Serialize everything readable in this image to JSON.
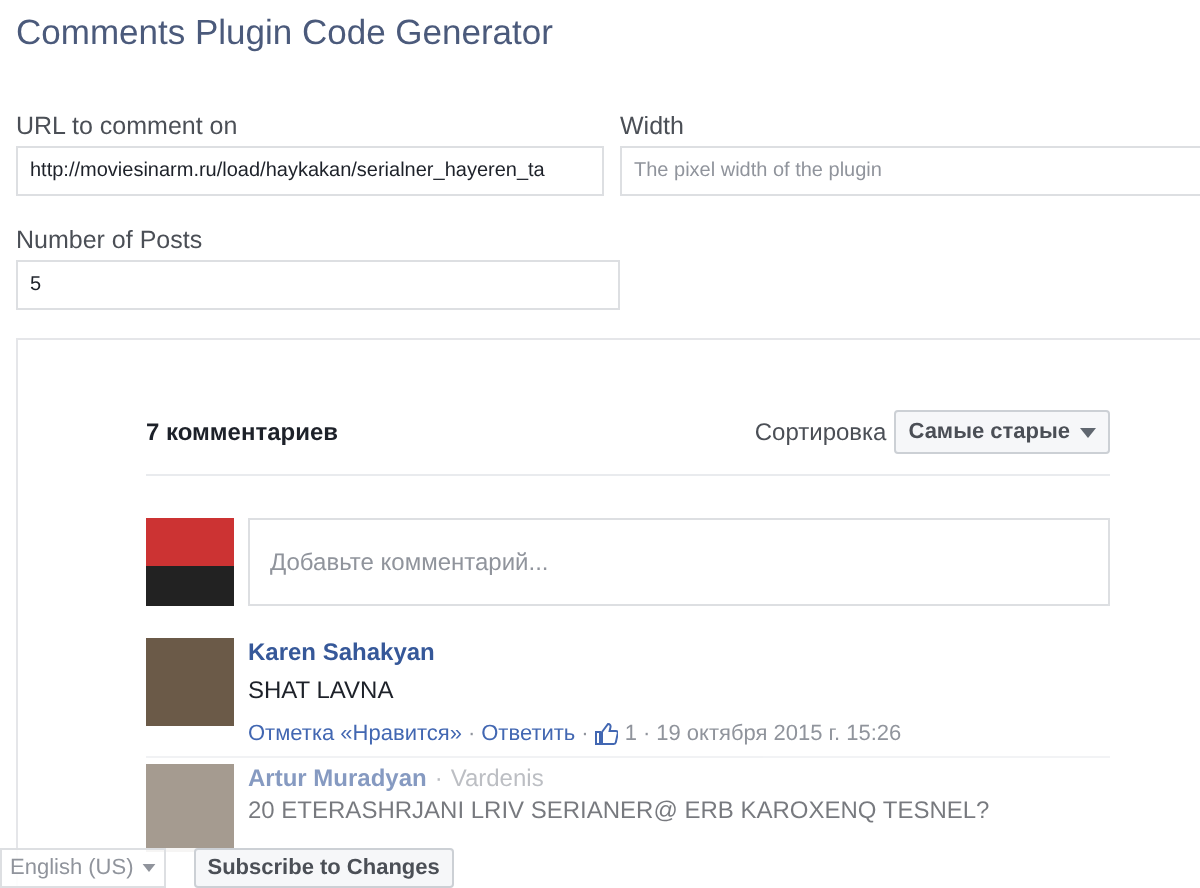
{
  "title": "Comments Plugin Code Generator",
  "fields": [
    {
      "label": "URL to comment on",
      "value": "http://moviesinarm.ru/load/haykakan/serialner_hayeren_ta"
    },
    {
      "label": "Width",
      "placeholder": "The pixel width of the plugin"
    },
    {
      "label": "Number of Posts",
      "value": "5"
    }
  ],
  "preview": {
    "count": "7 комментариев",
    "sort_label": "Сортировка",
    "sort_value": "Самые старые",
    "compose_placeholder": "Добавьте комментарий...",
    "separator": "·",
    "comments": [
      {
        "author": "Karen Sahakyan",
        "text": "SHAT LAVNA",
        "like": "Отметка «Нравится»",
        "reply": "Ответить",
        "likes": "1",
        "date": "19 октября 2015 г. 15:26"
      },
      {
        "author": "Artur Muradyan",
        "location": "Vardenis",
        "text": "20 ETERASHRJANI LRIV SERIANER@ ERB KAROXENQ TESNEL?"
      }
    ]
  },
  "footer": {
    "language": "English (US)",
    "subscribe": "Subscribe to Changes"
  }
}
